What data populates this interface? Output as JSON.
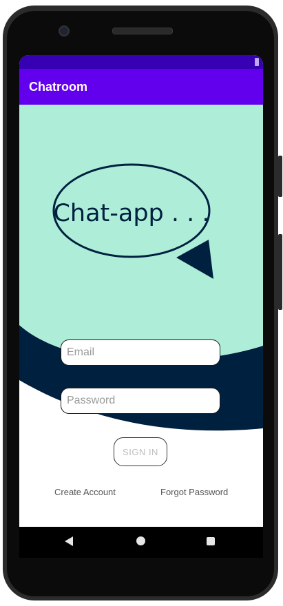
{
  "app_bar": {
    "title": "Chatroom"
  },
  "logo": {
    "text": "Chat-app . . ."
  },
  "form": {
    "email_placeholder": "Email",
    "email_value": "",
    "password_placeholder": "Password",
    "password_value": "",
    "sign_in_label": "SIGN IN"
  },
  "links": {
    "create_account": "Create Account",
    "forgot_password": "Forgot Password"
  },
  "colors": {
    "status_bar": "#3700B3",
    "app_bar": "#6200EE",
    "mint": "#AEEED8",
    "navy": "#00203F"
  },
  "nav_bar": {
    "icons": [
      "back-icon",
      "home-icon",
      "recents-icon"
    ]
  }
}
